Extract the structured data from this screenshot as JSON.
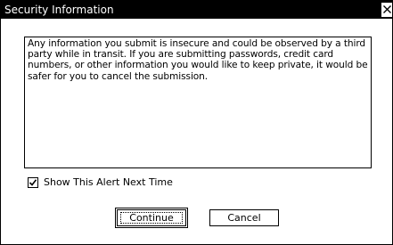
{
  "window": {
    "title": "Security Information"
  },
  "message": {
    "text": "Any information you submit is insecure and could be observed by a third party while in transit. If you are submitting passwords, credit card numbers, or other information you would like to keep private, it would be safer for you to cancel the submission."
  },
  "alert_checkbox": {
    "label": "Show This Alert Next Time",
    "checked": true
  },
  "buttons": {
    "continue_label": "Continue",
    "cancel_label": "Cancel"
  },
  "icons": {
    "close": "close-icon",
    "checkmark": "checkmark-icon"
  },
  "colors": {
    "titlebar_bg": "#000000",
    "titlebar_text": "#ffffff",
    "window_bg": "#ffffff",
    "border": "#000000"
  }
}
